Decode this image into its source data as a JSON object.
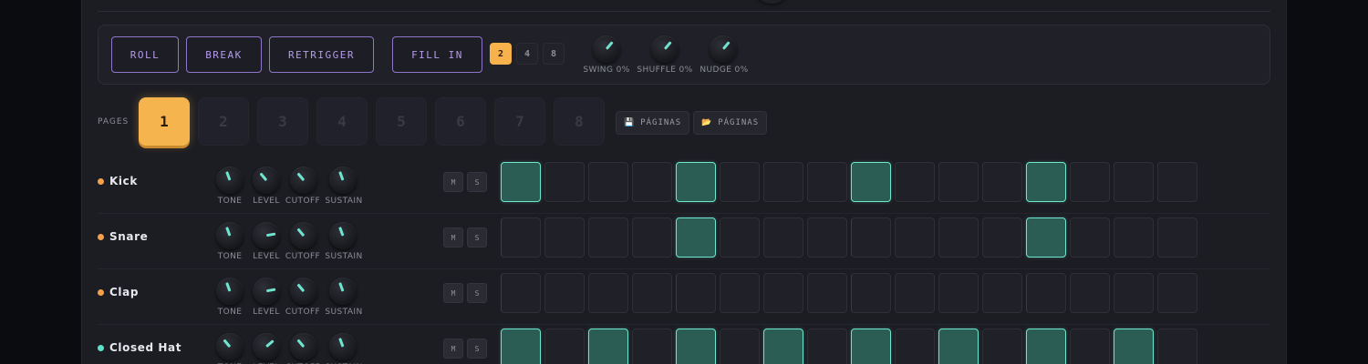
{
  "performance": {
    "buttons": [
      {
        "label": "ROLL"
      },
      {
        "label": "BREAK"
      },
      {
        "label": "RETRIGGER"
      },
      {
        "label": "FILL IN"
      }
    ],
    "divisions": [
      {
        "label": "2",
        "active": true
      },
      {
        "label": "4",
        "active": false
      },
      {
        "label": "8",
        "active": false
      }
    ],
    "knobs": [
      {
        "label": "SWING 0%"
      },
      {
        "label": "SHUFFLE 0%"
      },
      {
        "label": "NUDGE 0%"
      }
    ]
  },
  "pages": {
    "label": "PAGES",
    "items": [
      "1",
      "2",
      "3",
      "4",
      "5",
      "6",
      "7",
      "8"
    ],
    "active": "1",
    "save_icon": "floppy-disk-icon",
    "save_label": "PÁGINAS",
    "load_icon": "folder-icon",
    "load_label": "PÁGINAS"
  },
  "knob_labels": [
    "TONE",
    "LEVEL",
    "CUTOFF",
    "SUSTAIN"
  ],
  "mute_label": "M",
  "solo_label": "S",
  "colors": {
    "accent": "#f6b44f",
    "step_on": "#6fe5d0",
    "perf": "#b49be8"
  },
  "tracks": [
    {
      "name": "Kick",
      "dot": "#f6a04a",
      "steps": [
        1,
        0,
        0,
        0,
        1,
        0,
        0,
        0,
        1,
        0,
        0,
        0,
        1,
        0,
        0,
        0
      ]
    },
    {
      "name": "Snare",
      "dot": "#f6a04a",
      "steps": [
        0,
        0,
        0,
        0,
        1,
        0,
        0,
        0,
        0,
        0,
        0,
        0,
        1,
        0,
        0,
        0
      ]
    },
    {
      "name": "Clap",
      "dot": "#f6a04a",
      "steps": [
        0,
        0,
        0,
        0,
        0,
        0,
        0,
        0,
        0,
        0,
        0,
        0,
        0,
        0,
        0,
        0
      ]
    },
    {
      "name": "Closed Hat",
      "dot": "#5ee0c8",
      "steps": [
        1,
        0,
        1,
        0,
        1,
        0,
        1,
        0,
        1,
        0,
        1,
        0,
        1,
        0,
        1,
        0
      ]
    }
  ]
}
